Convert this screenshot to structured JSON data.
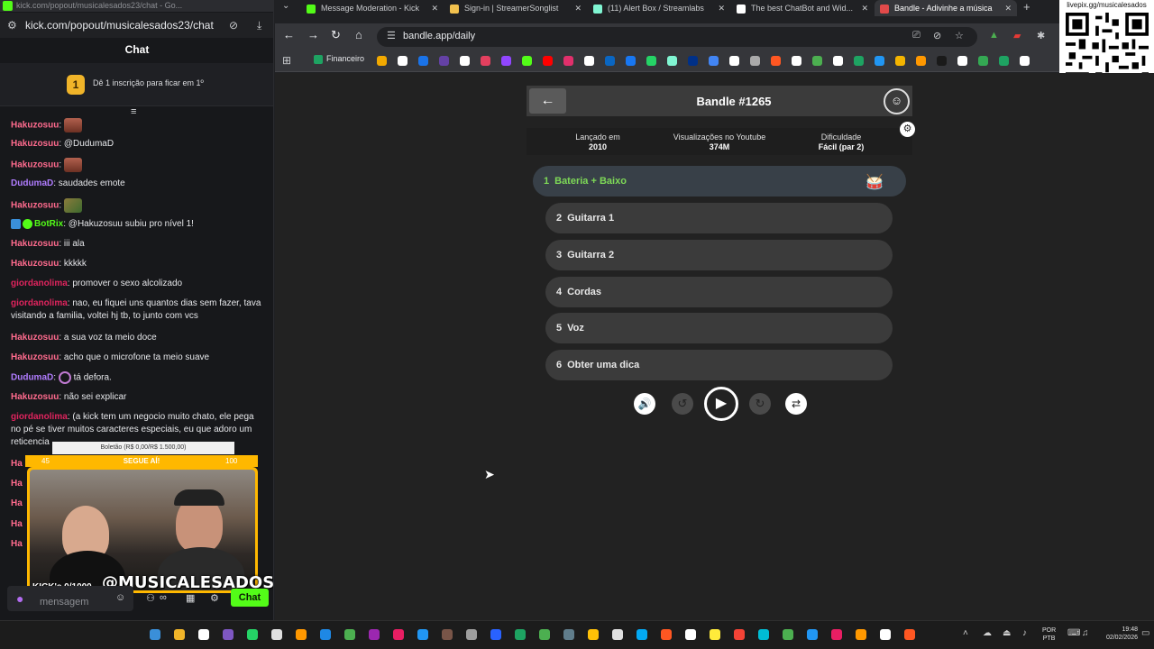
{
  "chat_window": {
    "titlebar": "kick.com/popout/musicalesados23/chat - Go...",
    "url": "kick.com/popout/musicalesados23/chat",
    "header": "Chat",
    "sub_badge": "1",
    "sub_banner": "Dê 1 inscrição para ficar em 1º",
    "messages": [
      {
        "user": "Hakuzosuu",
        "color": "#ff6b8e",
        "text": "",
        "emote": "a"
      },
      {
        "user": "Hakuzosuu",
        "color": "#ff6b8e",
        "text": "@DudumaD",
        "emote": ""
      },
      {
        "user": "Hakuzosuu",
        "color": "#ff6b8e",
        "text": "",
        "emote": "a"
      },
      {
        "user": "DudumaD",
        "color": "#b07cff",
        "text": "saudades emote",
        "emote": ""
      },
      {
        "user": "Hakuzosuu",
        "color": "#ff6b8e",
        "text": "",
        "emote": "b"
      },
      {
        "user": "BotRix",
        "color": "#53fc18",
        "text": "@Hakuzosuu subiu pro nível 1!",
        "emote": ""
      },
      {
        "user": "Hakuzosuu",
        "color": "#ff6b8e",
        "text": "iii ala",
        "emote": ""
      },
      {
        "user": "Hakuzosuu",
        "color": "#ff6b8e",
        "text": "kkkkk",
        "emote": ""
      },
      {
        "user": "giordanolima",
        "color": "#e0245e",
        "text": "promover o sexo alcolizado",
        "emote": ""
      },
      {
        "user": "giordanolima",
        "color": "#e0245e",
        "text": "nao, eu fiquei uns quantos dias sem fazer, tava visitando a familia, voltei hj tb, to junto com vcs",
        "emote": ""
      },
      {
        "user": "Hakuzosuu",
        "color": "#ff6b8e",
        "text": "a sua voz ta meio doce",
        "emote": ""
      },
      {
        "user": "Hakuzosuu",
        "color": "#ff6b8e",
        "text": "acho que o microfone ta meio suave",
        "emote": ""
      },
      {
        "user": "DudumaD",
        "color": "#b07cff",
        "text": "tá defora.",
        "emote": "c"
      },
      {
        "user": "Hakuzosuu",
        "color": "#ff6b8e",
        "text": "não sei explicar",
        "emote": ""
      },
      {
        "user": "giordanolima",
        "color": "#e0245e",
        "text": "(a kick tem um negocio muito chato, ele pega no pé se tiver muitos caracteres especiais, eu que adoro um reticencia",
        "emote": ""
      }
    ],
    "partial_user": "Ha",
    "input_placeholder": "mensagem",
    "send_label": "Chat",
    "overlay": {
      "goal_text": "Boletão (R$ 0,00/R$ 1.500,00)",
      "segue_text": "SEGUE AÍ!",
      "segue_left": "45",
      "segue_right": "100",
      "brand": "@MUSICALESADOS",
      "kicks": "KICK's 0/1000"
    }
  },
  "browser": {
    "tabs": [
      {
        "label": "Message Moderation - Kick",
        "color": "#53fc18",
        "active": false
      },
      {
        "label": "Sign-in | StreamerSonglist",
        "color": "#f2c14e",
        "active": false
      },
      {
        "label": "(11) Alert Box / Streamlabs",
        "color": "#80f5d2",
        "active": false
      },
      {
        "label": "The best ChatBot and Wid...",
        "color": "#ffffff",
        "active": false
      },
      {
        "label": "Bandle - Adivinhe a música",
        "color": "#e24a4a",
        "active": true
      }
    ],
    "url": "bandle.app/daily",
    "bookmark_financeiro": "Financeiro",
    "qr_label": "livepix.gg/musicalesados"
  },
  "bandle": {
    "title": "Bandle #1265",
    "info": [
      {
        "label": "Lançado em",
        "value": "2010"
      },
      {
        "label": "Visualizações no Youtube",
        "value": "374M"
      },
      {
        "label": "Dificuldade",
        "value": "Fácil (par 2)"
      }
    ],
    "tracks": [
      {
        "num": "1",
        "label": "Bateria + Baixo"
      },
      {
        "num": "2",
        "label": "Guitarra 1"
      },
      {
        "num": "3",
        "label": "Guitarra 2"
      },
      {
        "num": "4",
        "label": "Cordas"
      },
      {
        "num": "5",
        "label": "Voz"
      },
      {
        "num": "6",
        "label": "Obter uma dica"
      }
    ],
    "accent_color": "#7ed957"
  },
  "taskbar": {
    "lang_line1": "POR",
    "lang_line2": "PTB",
    "time": "19:48",
    "date": "02/02/2026"
  }
}
